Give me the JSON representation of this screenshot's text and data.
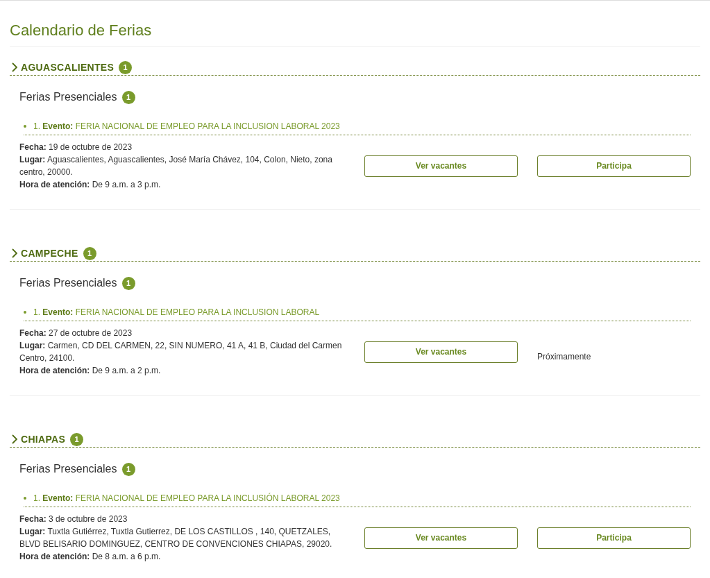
{
  "title": "Calendario de Ferias",
  "states": [
    {
      "name": "AGUASCALIENTES",
      "count": "1",
      "groups": [
        {
          "title": "Ferias Presenciales",
          "count": "1",
          "events": [
            {
              "event": "1. **Evento:** FERIA NACIONAL DE EMPLEO PARA LA INCLUSION LABORAL 2023",
              "details": [
                "**Fecha:** 19 de octubre de 2023",
                "**Lugar:** Aguascalientes, Aguascalientes, José María Chávez, 104, Colon, Nieto, zona centro, 20000.",
                "**Hora de atención:** De 9 a.m. a 3 p.m."
              ],
              "actions": [
                {
                  "kind": "button",
                  "label": "Ver vacantes"
                },
                {
                  "kind": "button",
                  "label": "Participa"
                }
              ]
            }
          ]
        }
      ]
    },
    {
      "name": "CAMPECHE",
      "count": "1",
      "groups": [
        {
          "title": "Ferias Presenciales",
          "count": "1",
          "events": [
            {
              "event": "1. **Evento:** FERIA NACIONAL DE EMPLEO PARA LA INCLUSION LABORAL",
              "details": [
                "**Fecha:** 27 de octubre de 2023",
                "**Lugar:** Carmen, CD DEL CARMEN, 22, SIN NUMERO, 41 A, 41 B, Ciudad del Carmen Centro, 24100.",
                "**Hora de atención:** De 9 a.m. a 2 p.m."
              ],
              "actions": [
                {
                  "kind": "button",
                  "label": "Ver vacantes"
                },
                {
                  "kind": "note",
                  "label": "Próximamente"
                }
              ]
            }
          ]
        }
      ]
    },
    {
      "name": "CHIAPAS",
      "count": "1",
      "groups": [
        {
          "title": "Ferias Presenciales",
          "count": "1",
          "events": [
            {
              "event": "1. **Evento:** FERIA NACIONAL DE EMPLEO PARA LA INCLUSIÓN LABORAL 2023",
              "details": [
                "**Fecha:** 3 de octubre de 2023",
                "**Lugar:** Tuxtla Gutiérrez, Tuxtla Gutierrez, DE LOS CASTILLOS , 140, QUETZALES, BLVD BELISARIO DOMINGUEZ, CENTRO DE CONVENCIONES CHIAPAS, 29020.",
                "**Hora de atención:** De 8 a.m. a 6 p.m."
              ],
              "actions": [
                {
                  "kind": "button",
                  "label": "Ver vacantes"
                },
                {
                  "kind": "button",
                  "label": "Participa"
                }
              ]
            }
          ]
        }
      ]
    }
  ]
}
